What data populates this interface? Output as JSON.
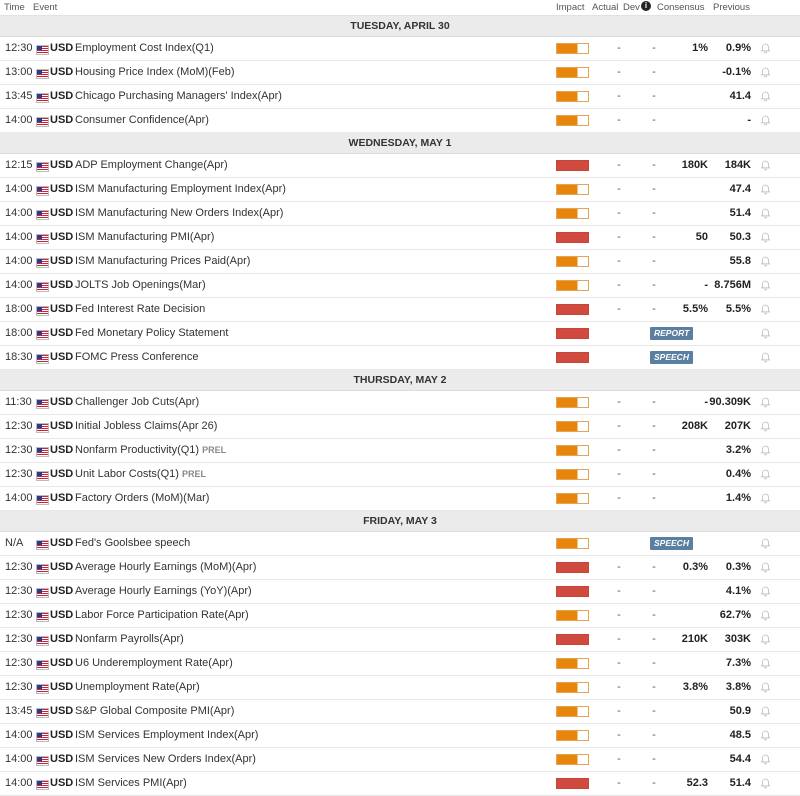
{
  "header": {
    "time": "Time",
    "event": "Event",
    "impact": "Impact",
    "actual": "Actual",
    "dev": "Dev",
    "info_icon": "i",
    "consensus": "Consensus",
    "previous": "Previous"
  },
  "colors": {
    "impact_medium": "#e8850c",
    "impact_high": "#d04a3f",
    "badge": "#5a7fa0"
  },
  "days": [
    {
      "label": "TUESDAY, APRIL 30",
      "rows": [
        {
          "time": "12:30",
          "cur": "USD",
          "event": "Employment Cost Index(Q1)",
          "impact": "medium",
          "actual": "-",
          "dev": "-",
          "consensus": "1%",
          "previous": "0.9%"
        },
        {
          "time": "13:00",
          "cur": "USD",
          "event": "Housing Price Index (MoM)(Feb)",
          "impact": "medium",
          "actual": "-",
          "dev": "-",
          "consensus": "",
          "previous": "-0.1%"
        },
        {
          "time": "13:45",
          "cur": "USD",
          "event": "Chicago Purchasing Managers' Index(Apr)",
          "impact": "medium",
          "actual": "-",
          "dev": "-",
          "consensus": "",
          "previous": "41.4"
        },
        {
          "time": "14:00",
          "cur": "USD",
          "event": "Consumer Confidence(Apr)",
          "impact": "medium",
          "actual": "-",
          "dev": "-",
          "consensus": "",
          "previous": "-"
        }
      ]
    },
    {
      "label": "WEDNESDAY, MAY 1",
      "rows": [
        {
          "time": "12:15",
          "cur": "USD",
          "event": "ADP Employment Change(Apr)",
          "impact": "high",
          "actual": "-",
          "dev": "-",
          "consensus": "180K",
          "previous": "184K"
        },
        {
          "time": "14:00",
          "cur": "USD",
          "event": "ISM Manufacturing Employment Index(Apr)",
          "impact": "medium",
          "actual": "-",
          "dev": "-",
          "consensus": "",
          "previous": "47.4"
        },
        {
          "time": "14:00",
          "cur": "USD",
          "event": "ISM Manufacturing New Orders Index(Apr)",
          "impact": "medium",
          "actual": "-",
          "dev": "-",
          "consensus": "",
          "previous": "51.4"
        },
        {
          "time": "14:00",
          "cur": "USD",
          "event": "ISM Manufacturing PMI(Apr)",
          "impact": "high",
          "actual": "-",
          "dev": "-",
          "consensus": "50",
          "previous": "50.3"
        },
        {
          "time": "14:00",
          "cur": "USD",
          "event": "ISM Manufacturing Prices Paid(Apr)",
          "impact": "medium",
          "actual": "-",
          "dev": "-",
          "consensus": "",
          "previous": "55.8"
        },
        {
          "time": "14:00",
          "cur": "USD",
          "event": "JOLTS Job Openings(Mar)",
          "impact": "medium",
          "actual": "-",
          "dev": "-",
          "consensus": "-",
          "previous": "8.756M"
        },
        {
          "time": "18:00",
          "cur": "USD",
          "event": "Fed Interest Rate Decision",
          "impact": "high",
          "actual": "-",
          "dev": "-",
          "consensus": "5.5%",
          "previous": "5.5%"
        },
        {
          "time": "18:00",
          "cur": "USD",
          "event": "Fed Monetary Policy Statement",
          "impact": "high",
          "badge": "REPORT"
        },
        {
          "time": "18:30",
          "cur": "USD",
          "event": "FOMC Press Conference",
          "impact": "high",
          "badge": "SPEECH"
        }
      ]
    },
    {
      "label": "THURSDAY, MAY 2",
      "rows": [
        {
          "time": "11:30",
          "cur": "USD",
          "event": "Challenger Job Cuts(Apr)",
          "impact": "medium",
          "actual": "-",
          "dev": "-",
          "consensus": "-",
          "previous": "90.309K"
        },
        {
          "time": "12:30",
          "cur": "USD",
          "event": "Initial Jobless Claims(Apr 26)",
          "impact": "medium",
          "actual": "-",
          "dev": "-",
          "consensus": "208K",
          "previous": "207K"
        },
        {
          "time": "12:30",
          "cur": "USD",
          "event": "Nonfarm Productivity(Q1)",
          "prel": "PREL",
          "impact": "medium",
          "actual": "-",
          "dev": "-",
          "consensus": "",
          "previous": "3.2%"
        },
        {
          "time": "12:30",
          "cur": "USD",
          "event": "Unit Labor Costs(Q1)",
          "prel": "PREL",
          "impact": "medium",
          "actual": "-",
          "dev": "-",
          "consensus": "",
          "previous": "0.4%"
        },
        {
          "time": "14:00",
          "cur": "USD",
          "event": "Factory Orders (MoM)(Mar)",
          "impact": "medium",
          "actual": "-",
          "dev": "-",
          "consensus": "",
          "previous": "1.4%"
        }
      ]
    },
    {
      "label": "FRIDAY, MAY 3",
      "rows": [
        {
          "time": "N/A",
          "cur": "USD",
          "event": "Fed's Goolsbee speech",
          "impact": "medium",
          "badge": "SPEECH"
        },
        {
          "time": "12:30",
          "cur": "USD",
          "event": "Average Hourly Earnings (MoM)(Apr)",
          "impact": "high",
          "actual": "-",
          "dev": "-",
          "consensus": "0.3%",
          "previous": "0.3%"
        },
        {
          "time": "12:30",
          "cur": "USD",
          "event": "Average Hourly Earnings (YoY)(Apr)",
          "impact": "high",
          "actual": "-",
          "dev": "-",
          "consensus": "",
          "previous": "4.1%"
        },
        {
          "time": "12:30",
          "cur": "USD",
          "event": "Labor Force Participation Rate(Apr)",
          "impact": "medium",
          "actual": "-",
          "dev": "-",
          "consensus": "",
          "previous": "62.7%"
        },
        {
          "time": "12:30",
          "cur": "USD",
          "event": "Nonfarm Payrolls(Apr)",
          "impact": "high",
          "actual": "-",
          "dev": "-",
          "consensus": "210K",
          "previous": "303K"
        },
        {
          "time": "12:30",
          "cur": "USD",
          "event": "U6 Underemployment Rate(Apr)",
          "impact": "medium",
          "actual": "-",
          "dev": "-",
          "consensus": "",
          "previous": "7.3%"
        },
        {
          "time": "12:30",
          "cur": "USD",
          "event": "Unemployment Rate(Apr)",
          "impact": "medium",
          "actual": "-",
          "dev": "-",
          "consensus": "3.8%",
          "previous": "3.8%"
        },
        {
          "time": "13:45",
          "cur": "USD",
          "event": "S&P Global Composite PMI(Apr)",
          "impact": "medium",
          "actual": "-",
          "dev": "-",
          "consensus": "",
          "previous": "50.9"
        },
        {
          "time": "14:00",
          "cur": "USD",
          "event": "ISM Services Employment Index(Apr)",
          "impact": "medium",
          "actual": "-",
          "dev": "-",
          "consensus": "",
          "previous": "48.5"
        },
        {
          "time": "14:00",
          "cur": "USD",
          "event": "ISM Services New Orders Index(Apr)",
          "impact": "medium",
          "actual": "-",
          "dev": "-",
          "consensus": "",
          "previous": "54.4"
        },
        {
          "time": "14:00",
          "cur": "USD",
          "event": "ISM Services PMI(Apr)",
          "impact": "high",
          "actual": "-",
          "dev": "-",
          "consensus": "52.3",
          "previous": "51.4"
        }
      ]
    }
  ]
}
